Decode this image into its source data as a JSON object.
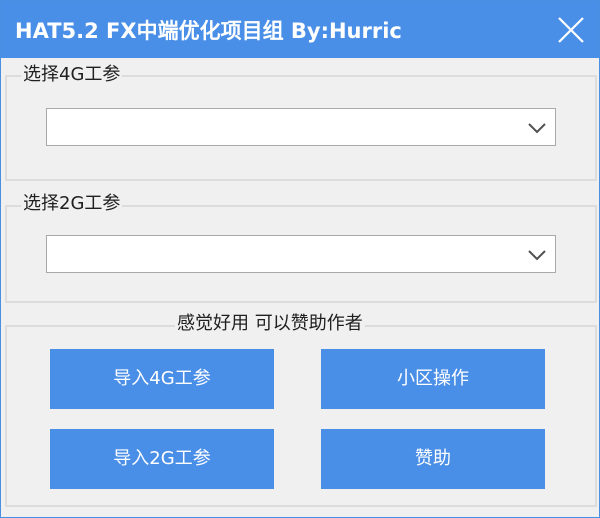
{
  "window": {
    "title": "HAT5.2  FX中端优化项目组 By:Hurric"
  },
  "group_4g": {
    "legend": "选择4G工参",
    "combo_value": ""
  },
  "group_2g": {
    "legend": "选择2G工参",
    "combo_value": ""
  },
  "group_actions": {
    "legend": "感觉好用 可以赞助作者",
    "buttons": {
      "import_4g": "导入4G工参",
      "cell_ops": "小区操作",
      "import_2g": "导入2G工参",
      "donate": "赞助"
    }
  },
  "colors": {
    "accent": "#4a8fe7",
    "background": "#f0f0f0",
    "group_border": "#dcdcdc"
  },
  "icons": {
    "close": "close-icon",
    "dropdown": "chevron-down-icon"
  }
}
